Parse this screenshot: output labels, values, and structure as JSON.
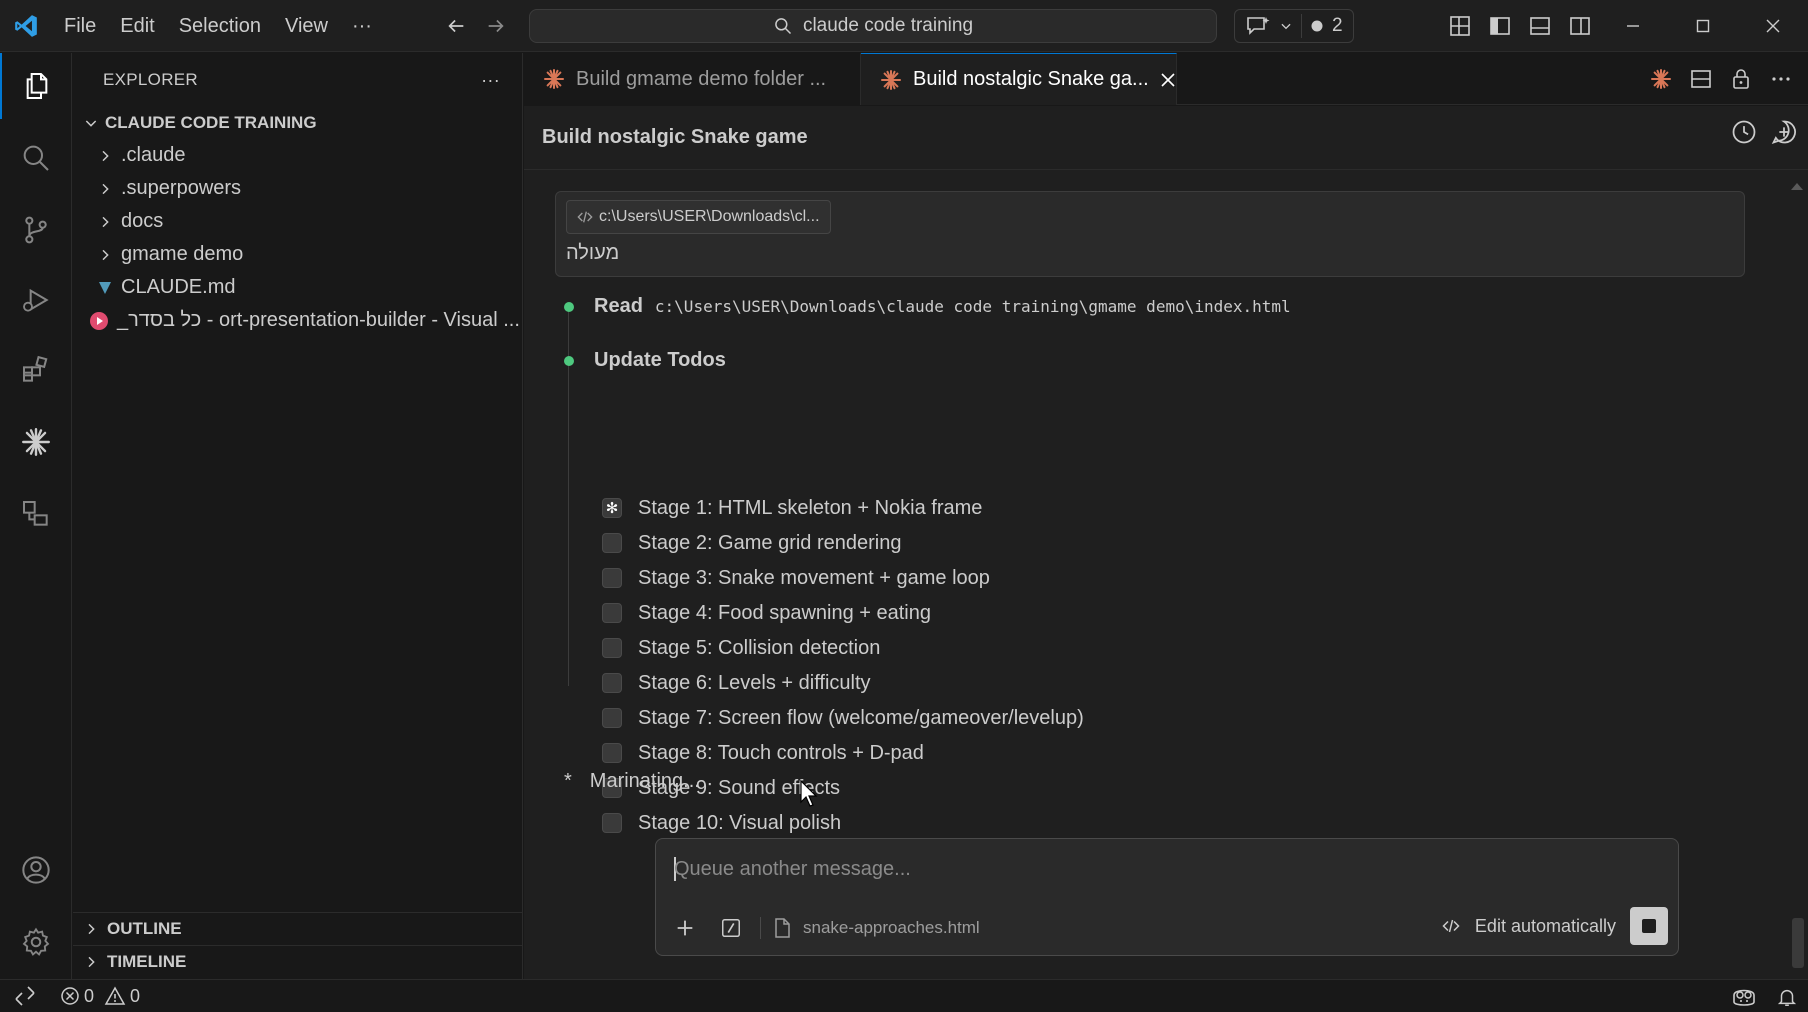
{
  "titlebar": {
    "menu": [
      "File",
      "Edit",
      "Selection",
      "View",
      "···"
    ],
    "search_text": "claude code training",
    "badge_count": "2",
    "colors": {
      "accent": "#0078d4",
      "claude": "#d97757"
    }
  },
  "sidebar": {
    "header": "EXPLORER",
    "header_more": "···",
    "root": "CLAUDE CODE TRAINING",
    "items": [
      {
        "label": ".claude",
        "type": "folder"
      },
      {
        "label": ".superpowers",
        "type": "folder"
      },
      {
        "label": "docs",
        "type": "folder"
      },
      {
        "label": "gmame demo",
        "type": "folder"
      },
      {
        "label": "CLAUDE.md",
        "type": "markdown-file"
      },
      {
        "label": "_כל בסדר - ort-presentation-builder - Visual ...",
        "type": "video-file"
      }
    ],
    "outline": "OUTLINE",
    "timeline": "TIMELINE"
  },
  "tabs": [
    {
      "label": "Build gmame demo folder ...",
      "active": false
    },
    {
      "label": "Build nostalgic Snake ga...",
      "active": true
    }
  ],
  "chat": {
    "title": "Build nostalgic Snake game",
    "user_message": {
      "context_chip": "c:\\Users\\USER\\Downloads\\cl...",
      "text": "מעולה"
    },
    "read_step": {
      "label": "Read",
      "path": "c:\\Users\\USER\\Downloads\\claude code training\\gmame demo\\index.html"
    },
    "todos_step": {
      "label": "Update Todos",
      "items": [
        {
          "label": "Stage 1: HTML skeleton + Nokia frame",
          "state": "in-progress"
        },
        {
          "label": "Stage 2: Game grid rendering",
          "state": "pending"
        },
        {
          "label": "Stage 3: Snake movement + game loop",
          "state": "pending"
        },
        {
          "label": "Stage 4: Food spawning + eating",
          "state": "pending"
        },
        {
          "label": "Stage 5: Collision detection",
          "state": "pending"
        },
        {
          "label": "Stage 6: Levels + difficulty",
          "state": "pending"
        },
        {
          "label": "Stage 7: Screen flow (welcome/gameover/levelup)",
          "state": "pending"
        },
        {
          "label": "Stage 8: Touch controls + D-pad",
          "state": "pending"
        },
        {
          "label": "Stage 9: Sound effects",
          "state": "pending"
        },
        {
          "label": "Stage 10: Visual polish",
          "state": "pending"
        }
      ]
    },
    "status_glyph": "*",
    "status_text": "Marinating...",
    "input": {
      "placeholder": "Queue another message...",
      "attached_file": "snake-approaches.html",
      "edit_mode": "Edit automatically"
    }
  },
  "statusbar": {
    "errors": "0",
    "warnings": "0"
  }
}
